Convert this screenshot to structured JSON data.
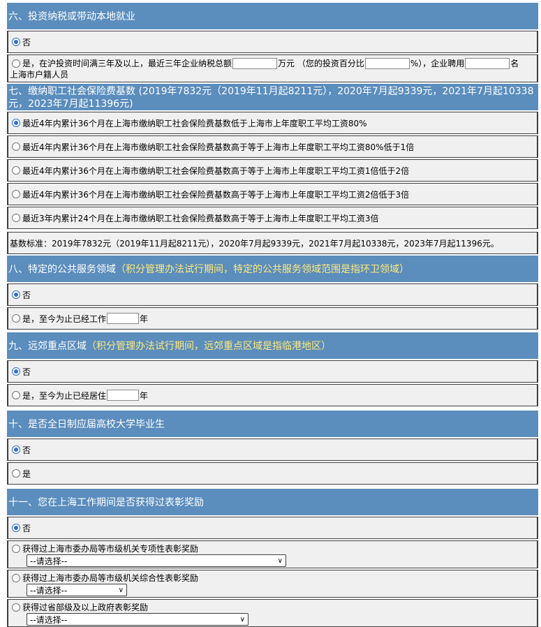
{
  "sections": {
    "s6": {
      "title": "六、投资纳税或带动本地就业"
    },
    "s7": {
      "title": "七、缴纳职工社会保险费基数 (2019年7832元（2019年11月起8211元），2020年7月起9339元，2021年7月起10338元，2023年7月起11396元)"
    },
    "s8": {
      "title": "八、特定的公共服务领域",
      "note": "（积分管理办法试行期间，特定的公共服务领域范围是指环卫领域）"
    },
    "s9": {
      "title": "九、远郊重点区域",
      "note": "（积分管理办法试行期间，远郊重点区域是指临港地区）"
    },
    "s10": {
      "title": "十、是否全日制应届高校大学毕业生"
    },
    "s11": {
      "title": "十一、您在上海工作期间是否获得过表彰奖励"
    }
  },
  "s6": {
    "no": "否",
    "yes_a": "是，在沪投资时间满三年及以上，最近三年企业纳税总额",
    "yes_b": "万元 （您的投资百分比",
    "yes_c": "%），企业聘用",
    "yes_d": "名",
    "yes_e": "上海市户籍人员"
  },
  "s7": {
    "opts": [
      "最近4年内累计36个月在上海市缴纳职工社会保险费基数低于上海市上年度职工平均工资80%",
      "最近4年内累计36个月在上海市缴纳职工社会保险费基数高于等于上海市上年度职工平均工资80%低于1倍",
      "最近4年内累计36个月在上海市缴纳职工社会保险费基数高于等于上海市上年度职工平均工资1倍低于2倍",
      "最近4年内累计36个月在上海市缴纳职工社会保险费基数高于等于上海市上年度职工平均工资2倍低于3倍",
      "最近3年内累计24个月在上海市缴纳职工社会保险费基数高于等于上海市上年度职工平均工资3倍"
    ],
    "base": "基数标准：2019年7832元（2019年11月起8211元），2020年7月起9339元，2021年7月起10338元，2023年7月起11396元。"
  },
  "s8": {
    "no": "否",
    "yes_a": "是，至今为止已经工作",
    "yes_b": "年"
  },
  "s9": {
    "no": "否",
    "yes_a": "是，至今为止已经居住",
    "yes_b": "年"
  },
  "s10": {
    "no": "否",
    "yes": "是"
  },
  "s11": {
    "no": "否",
    "a1": "获得过上海市委办局等市级机关专项性表彰奖励",
    "a2": "获得过上海市委办局等市级机关综合性表彰奖励",
    "a3": "获得过省部级及以上政府表彰奖励",
    "select": "--请选择--"
  }
}
